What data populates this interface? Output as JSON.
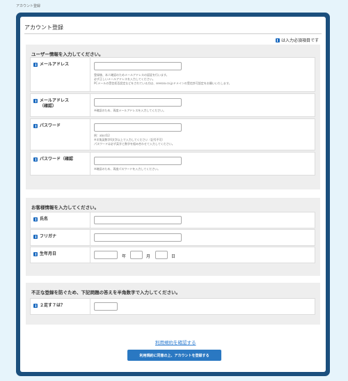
{
  "breadcrumb": "アカウント登録",
  "page_title": "アカウント登録",
  "required_note": "は入力必須項目です",
  "user_section": {
    "heading": "ユーザー情報を入力してください。",
    "email": {
      "label": "メールアドレス",
      "notes": [
        "登録後、本人確認のためメールアドレスの認証を行います。",
        "必ず正しいメールアドレスを入力してください。",
        "PCメールの受信拒否設定などをされている方は、seesaa.co.jpドメインの受信許可設定をお願いいたします。"
      ]
    },
    "email_confirm": {
      "label": "メールアドレス",
      "label2": "（確認）",
      "note": "※確認のため、再度メールアドレスを入力してください。"
    },
    "password": {
      "label": "パスワード",
      "notes": [
        "例：abcd12",
        "※半角英数字6文字以上で入力してください（記号不可）",
        "パスワードは必ず英字と数字を組み合わせて入力してください。"
      ]
    },
    "password_confirm": {
      "label": "パスワード（確認",
      "note": "※確認のため、再度パスワードを入力してください。"
    }
  },
  "customer_section": {
    "heading": "お客様情報を入力してください。",
    "name_label": "氏名",
    "kana_label": "フリガナ",
    "birth_label": "生年月日",
    "year_unit": "年",
    "month_unit": "月",
    "day_unit": "日"
  },
  "verify_section": {
    "heading": "不正な登録を防ぐため、下記問題の答えを半角数字で入力してください。",
    "question_label": "２足す７は？"
  },
  "terms_link": "利用規約を確認する",
  "submit_label": "利用規約に同意の上、アカウントを登録する"
}
